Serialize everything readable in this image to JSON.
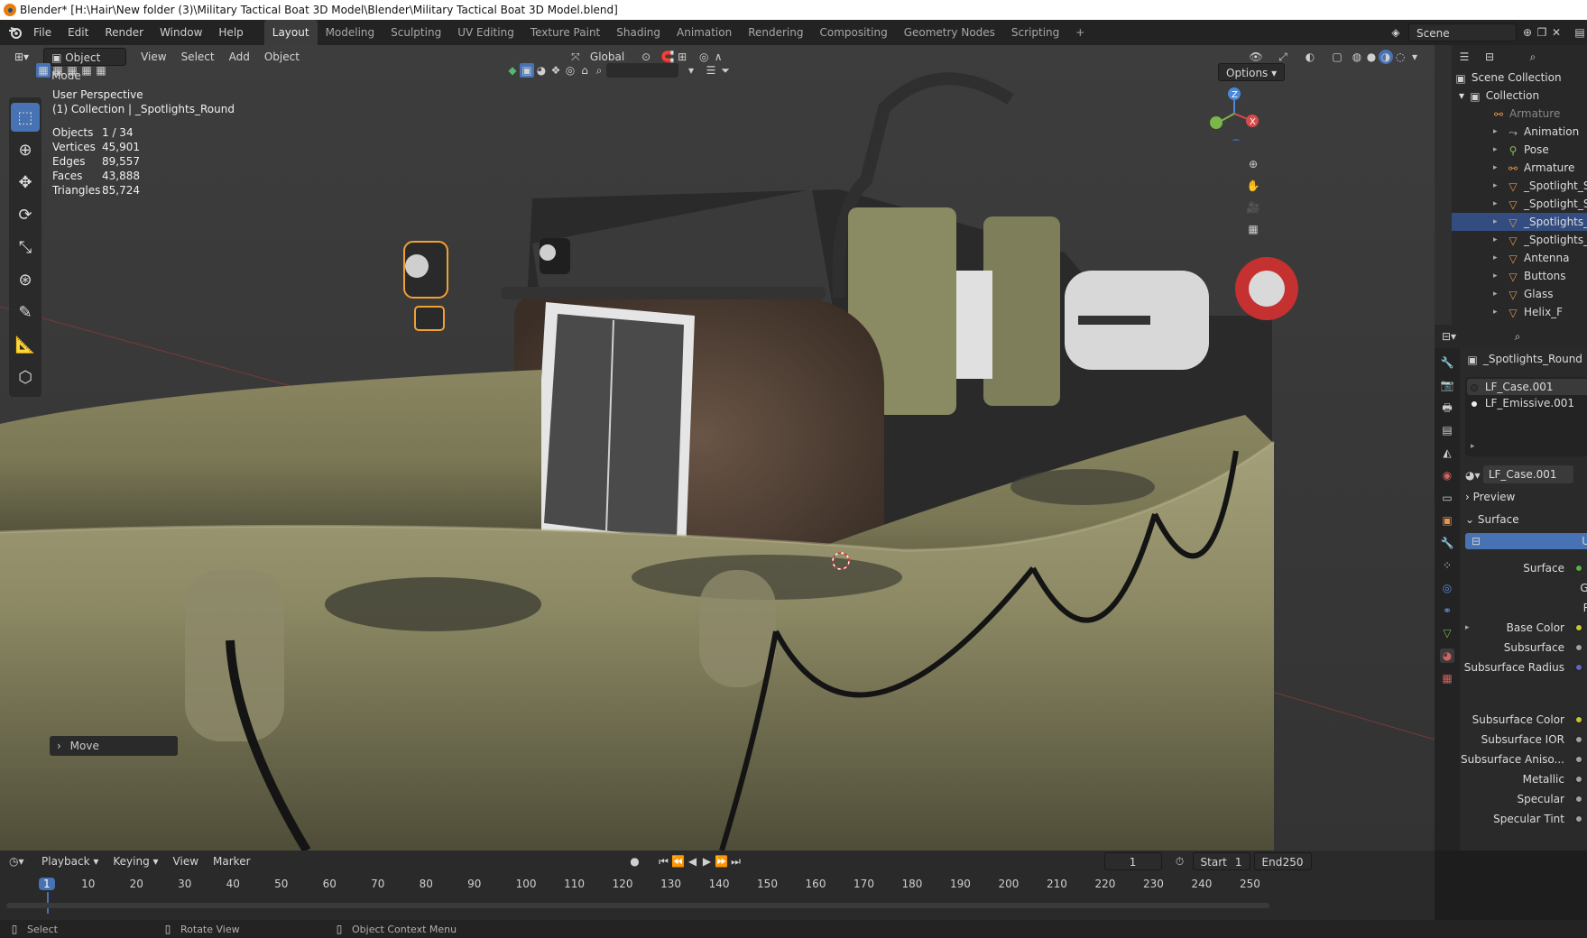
{
  "window": {
    "title": "Blender* [H:\\Hair\\New folder (3)\\Military Tactical Boat 3D Model\\Blender\\Military Tactical Boat 3D Model.blend]"
  },
  "menu": [
    "File",
    "Edit",
    "Render",
    "Window",
    "Help"
  ],
  "workspaces": [
    "Layout",
    "Modeling",
    "Sculpting",
    "UV Editing",
    "Texture Paint",
    "Shading",
    "Animation",
    "Rendering",
    "Compositing",
    "Geometry Nodes",
    "Scripting"
  ],
  "active_workspace": "Layout",
  "scene_label": "Scene",
  "viewport": {
    "mode": "Object Mode",
    "menus": [
      "View",
      "Select",
      "Add",
      "Object"
    ],
    "orientation": "Global",
    "options_label": "Options",
    "perspective": "User Perspective",
    "collection_info": "(1) Collection | _Spotlights_Round",
    "stats": [
      {
        "label": "Objects",
        "value": "1 / 34"
      },
      {
        "label": "Vertices",
        "value": "45,901"
      },
      {
        "label": "Edges",
        "value": "89,557"
      },
      {
        "label": "Faces",
        "value": "43,888"
      },
      {
        "label": "Triangles",
        "value": "85,724"
      }
    ],
    "last_op": "Move"
  },
  "outliner": {
    "root": "Scene Collection",
    "collection": "Collection",
    "items": [
      {
        "name": "Armature",
        "type": "armature",
        "dim": true,
        "indent": 0
      },
      {
        "name": "Animation",
        "type": "anim",
        "indent": 1
      },
      {
        "name": "Pose",
        "type": "pose",
        "indent": 1
      },
      {
        "name": "Armature",
        "type": "armature",
        "indent": 1
      },
      {
        "name": "_Spotlight_Sq",
        "type": "mesh",
        "indent": 1
      },
      {
        "name": "_Spotlight_Sq",
        "type": "mesh",
        "indent": 1
      },
      {
        "name": "_Spotlights_R",
        "type": "mesh",
        "indent": 1,
        "selected": true
      },
      {
        "name": "_Spotlights_R",
        "type": "mesh",
        "indent": 1
      },
      {
        "name": "Antenna",
        "type": "mesh",
        "indent": 1
      },
      {
        "name": "Buttons",
        "type": "mesh",
        "indent": 1
      },
      {
        "name": "Glass",
        "type": "mesh",
        "indent": 1
      },
      {
        "name": "Helix_F",
        "type": "mesh",
        "indent": 1
      }
    ]
  },
  "properties": {
    "object_name": "_Spotlights_Round",
    "materials": [
      "LF_Case.001",
      "LF_Emissive.001"
    ],
    "active_material": "LF_Case.001",
    "sections": [
      "Preview",
      "Surface"
    ],
    "surface_field": "U",
    "rows": [
      {
        "label": "Surface",
        "color": "#58b043"
      },
      {
        "label": "GG",
        "color": ""
      },
      {
        "label": "Ra",
        "color": ""
      },
      {
        "label": "Base Color",
        "color": "#c7c729"
      },
      {
        "label": "Subsurface",
        "color": "#a1a1a1"
      },
      {
        "label": "Subsurface Radius",
        "color": "#6363c7"
      },
      {
        "label": "Subsurface Color",
        "color": "#c7c729"
      },
      {
        "label": "Subsurface IOR",
        "color": "#a1a1a1"
      },
      {
        "label": "Subsurface Aniso...",
        "color": "#a1a1a1"
      },
      {
        "label": "Metallic",
        "color": "#a1a1a1"
      },
      {
        "label": "Specular",
        "color": "#a1a1a1"
      },
      {
        "label": "Specular Tint",
        "color": "#a1a1a1"
      }
    ]
  },
  "timeline": {
    "menus": [
      "Playback",
      "Keying",
      "View",
      "Marker"
    ],
    "current_frame": "1",
    "start_label": "Start",
    "start": "1",
    "end_label": "End",
    "end": "250",
    "ticks": [
      "1",
      "10",
      "20",
      "30",
      "40",
      "50",
      "60",
      "70",
      "80",
      "90",
      "100",
      "110",
      "120",
      "130",
      "140",
      "150",
      "160",
      "170",
      "180",
      "190",
      "200",
      "210",
      "220",
      "230",
      "240",
      "250"
    ]
  },
  "statusbar": [
    "Select",
    "Rotate View",
    "Object Context Menu"
  ]
}
